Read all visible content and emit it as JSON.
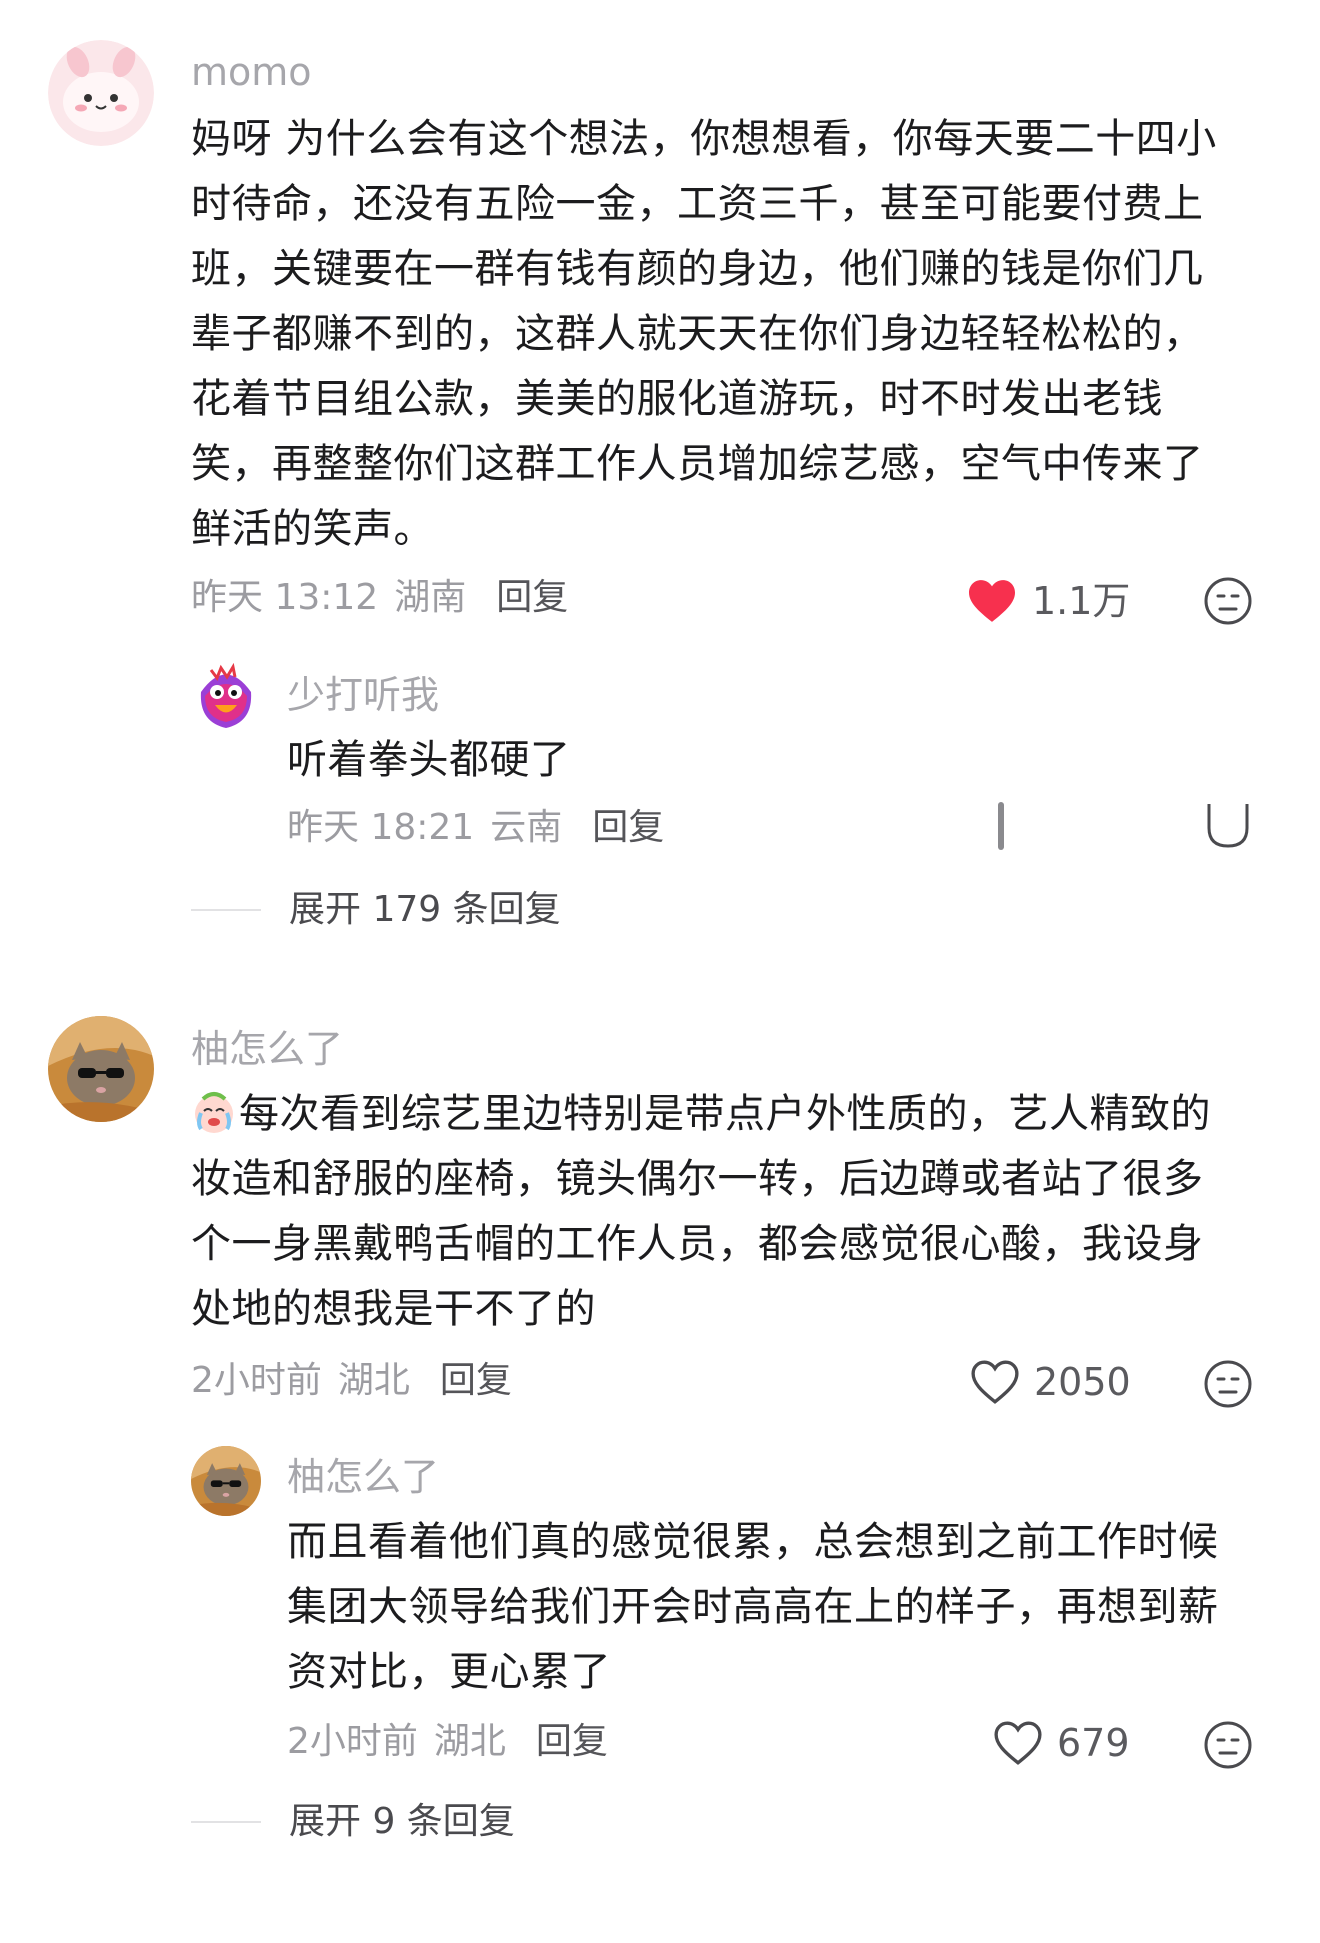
{
  "comments": [
    {
      "username": "momo",
      "text": "妈呀 为什么会有这个想法，你想想看，你每天要二十四小时待命，还没有五险一金，工资三千，甚至可能要付费上班，关键要在一群有钱有颜的身边，他们赚的钱是你们几辈子都赚不到的，这群人就天天在你们身边轻轻松松的，花着节目组公款，美美的服化道游玩，时不时发出老钱笑，再整整你们这群工作人员增加综艺感，空气中传来了鲜活的笑声。",
      "time": "昨天 13:12",
      "location": "湖南",
      "reply_label": "回复",
      "likes": "1.1万",
      "liked": true,
      "avatar_icon": "pink-bunny-avatar-icon",
      "replies": [
        {
          "username": "少打听我",
          "text": "听着拳头都硬了",
          "time": "昨天 18:21",
          "location": "云南",
          "reply_label": "回复",
          "avatar_icon": "colorful-monster-avatar-icon"
        }
      ],
      "expand_label": "展开 179 条回复"
    },
    {
      "username": "柚怎么了",
      "emoji_icon": "crying-face-emoji-icon",
      "text": "每次看到综艺里边特别是带点户外性质的，艺人精致的妆造和舒服的座椅，镜头偶尔一转，后边蹲或者站了很多个一身黑戴鸭舌帽的工作人员，都会感觉很心酸，我设身处地的想我是干不了的",
      "time": "2小时前",
      "location": "湖北",
      "reply_label": "回复",
      "likes": "2050",
      "liked": false,
      "avatar_icon": "cat-sunglasses-avatar-icon",
      "replies": [
        {
          "username": "柚怎么了",
          "text": "而且看着他们真的感觉很累，总会想到之前工作时候集团大领导给我们开会时高高在上的样子，再想到薪资对比，更心累了",
          "time": "2小时前",
          "location": "湖北",
          "reply_label": "回复",
          "likes": "679",
          "avatar_icon": "cat-sunglasses-avatar-icon"
        }
      ],
      "expand_label": "展开 9 条回复"
    }
  ],
  "colors": {
    "like_red": "#f7304e",
    "username_grey": "#a6a6ab",
    "text_dark": "#1c1c1e"
  }
}
